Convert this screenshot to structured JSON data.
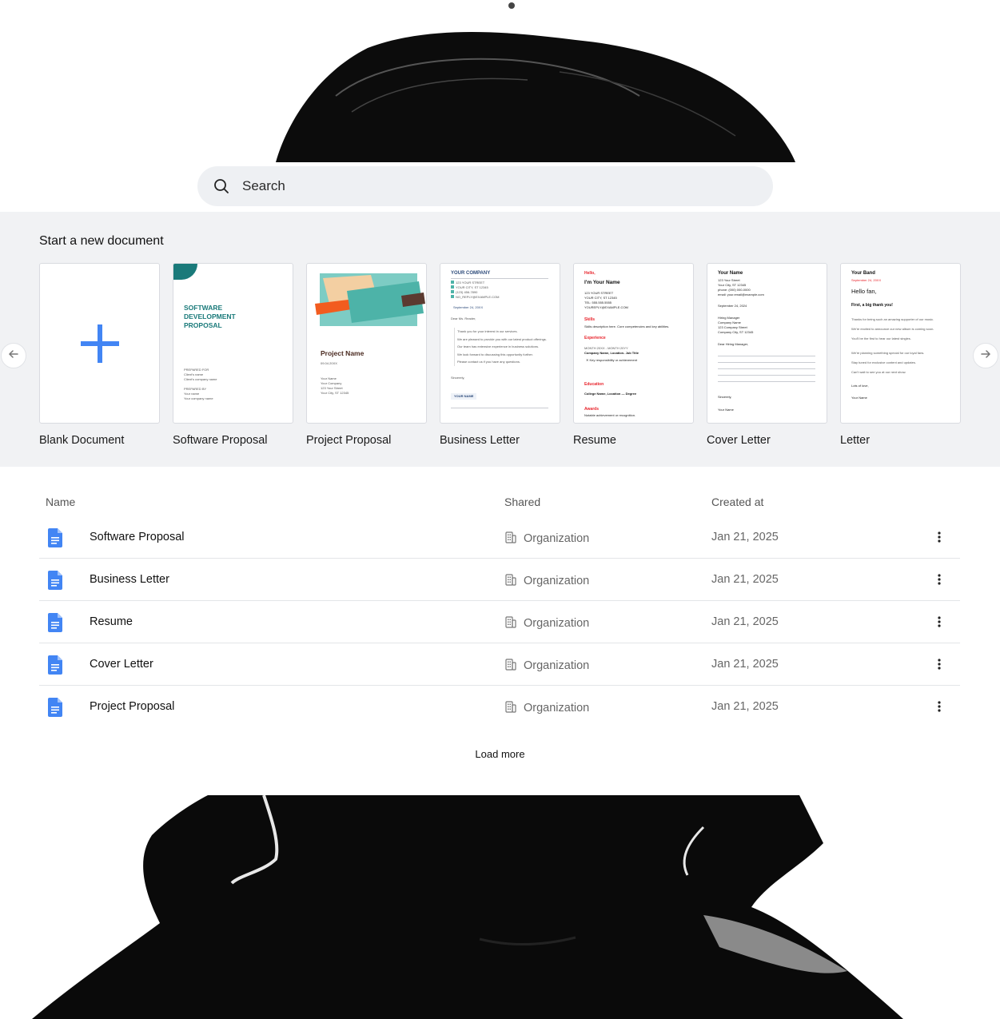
{
  "search": {
    "placeholder": "Search"
  },
  "templates": {
    "title": "Start a new document",
    "items": [
      {
        "label": "Blank Document"
      },
      {
        "label": "Software Proposal",
        "preview": {
          "heading_l1": "SOFTWARE",
          "heading_l2": "DEVELOPMENT",
          "heading_l3": "PROPOSAL",
          "prepared_for": "PREPARED FOR",
          "client_name": "Client's name",
          "client_company": "Client's company name",
          "prepared_by": "PREPARED BY",
          "your_name": "Your name",
          "your_company": "Your company name"
        }
      },
      {
        "label": "Project Proposal",
        "preview": {
          "title": "Project Name",
          "date": "09.04.20XX",
          "line1": "Your Name",
          "line2": "Your Company",
          "line3": "123 Your Street",
          "line4": "Your City, ST 12345"
        }
      },
      {
        "label": "Business Letter",
        "preview": {
          "company": "YOUR COMPANY",
          "addr1": "123 YOUR STREET",
          "addr2": "YOUR CITY, ST 12345",
          "addr3": "(123) 456-7890",
          "addr4": "NO_REPLY@EXAMPLE.COM",
          "date": "September 24, 20XX",
          "greeting": "Dear Ms. Reader,",
          "p1": "Thank you for your interest in our services.",
          "p2": "We are pleased to provide you with our latest product offerings.",
          "p3": "Our team has extensive experience in business solutions.",
          "p4": "We look forward to discussing this opportunity further.",
          "p5": "Please contact us if you have any questions.",
          "closing": "Sincerely,",
          "sign": "YOUR NAME"
        }
      },
      {
        "label": "Resume",
        "preview": {
          "hello": "Hello,",
          "name": "I'm Your Name",
          "a1": "123 YOUR STREET",
          "a2": "YOUR CITY, ST 12345",
          "a3": "TEL: 555.555.5555",
          "a4": "YOUREPLY@EXAMPLE.COM",
          "skills": "Skills",
          "skills_text": "Skills description here. Core competencies and key abilities.",
          "experience": "Experience",
          "exp_date": "MONTH 20XX - MONTH 20YY",
          "exp_role": "Company Name, Location- Job Title",
          "exp_item": "Key responsibility or achievement",
          "education": "Education",
          "edu_text": "College Name, Location — Degree",
          "awards": "Awards",
          "awards_text": "Notable achievement or recognition."
        }
      },
      {
        "label": "Cover Letter",
        "preview": {
          "name": "Your Name",
          "a1": "123 Your Street",
          "a2": "Your City, ST 12345",
          "a3": "phone: (000) 000-0000",
          "a4": "email: your.email@example.com",
          "date": "September 24, 2024",
          "r1": "Hiring Manager",
          "r2": "Company Name",
          "r3": "123 Company Street",
          "r4": "Company City, ST 12345",
          "greeting": "Dear Hiring Manager,",
          "closing": "Sincerely,",
          "sign": "Your Name"
        }
      },
      {
        "label": "Letter",
        "preview": {
          "band": "Your Band",
          "date": "September 24, 20XX",
          "hello": "Hello fan,",
          "thanks": "First, a big thank you!",
          "p1": "Thanks for being such an amazing supporter of our music.",
          "p2": "We're excited to announce our new album is coming soon.",
          "p3": "You'll be the first to hear our latest singles.",
          "p4": "We're planning something special for our loyal fans.",
          "p5": "Stay tuned for exclusive content and updates.",
          "p6": "Can't wait to see you at our next show.",
          "closing": "Lots of love,",
          "sign": "Your Name"
        }
      }
    ]
  },
  "table": {
    "headers": {
      "name": "Name",
      "shared": "Shared",
      "created": "Created at"
    },
    "rows": [
      {
        "name": "Software Proposal",
        "shared": "Organization",
        "created": "Jan 21, 2025"
      },
      {
        "name": "Business Letter",
        "shared": "Organization",
        "created": "Jan 21, 2025"
      },
      {
        "name": "Resume",
        "shared": "Organization",
        "created": "Jan 21, 2025"
      },
      {
        "name": "Cover Letter",
        "shared": "Organization",
        "created": "Jan 21, 2025"
      },
      {
        "name": "Project Proposal",
        "shared": "Organization",
        "created": "Jan 21, 2025"
      }
    ],
    "load_more": "Load more"
  },
  "colors": {
    "accent": "#4285f4",
    "teal": "#1a7a7a",
    "resume_red": "#e8232b",
    "section_bg": "#f1f2f4"
  },
  "icons": {
    "search": "search-icon",
    "doc": "doc-icon",
    "building": "building-icon",
    "more": "more-vert-icon",
    "prev": "arrow-left-icon",
    "next": "arrow-right-icon",
    "plus": "plus-icon"
  }
}
